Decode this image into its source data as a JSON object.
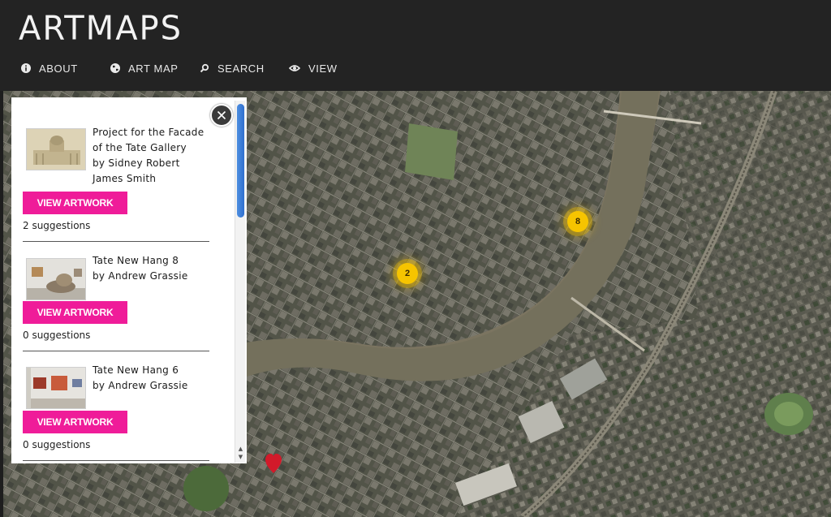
{
  "app": {
    "logo": "ARTMAPS"
  },
  "nav": {
    "items": [
      {
        "label": "ABOUT",
        "icon": "info-icon"
      },
      {
        "label": "ART MAP",
        "icon": "globe-icon"
      },
      {
        "label": "SEARCH",
        "icon": "search-icon"
      },
      {
        "label": "VIEW",
        "icon": "eye-icon"
      }
    ]
  },
  "map": {
    "clusters": [
      {
        "count": "2"
      },
      {
        "count": "8"
      }
    ],
    "accent": "#f6c400",
    "pin_color": "#d21a2a"
  },
  "panel": {
    "button_color": "#ef1c99",
    "items": [
      {
        "title_lines": [
          "Project for the Facade",
          "of the Tate Gallery",
          "by Sidney Robert",
          "James Smith"
        ],
        "button_label": "VIEW ARTWORK",
        "suggestions": "2 suggestions"
      },
      {
        "title_lines": [
          "Tate New Hang 8",
          "by Andrew Grassie"
        ],
        "button_label": "VIEW ARTWORK",
        "suggestions": "0 suggestions"
      },
      {
        "title_lines": [
          "Tate New Hang 6",
          "by Andrew Grassie"
        ],
        "button_label": "VIEW ARTWORK",
        "suggestions": "0 suggestions"
      }
    ]
  }
}
